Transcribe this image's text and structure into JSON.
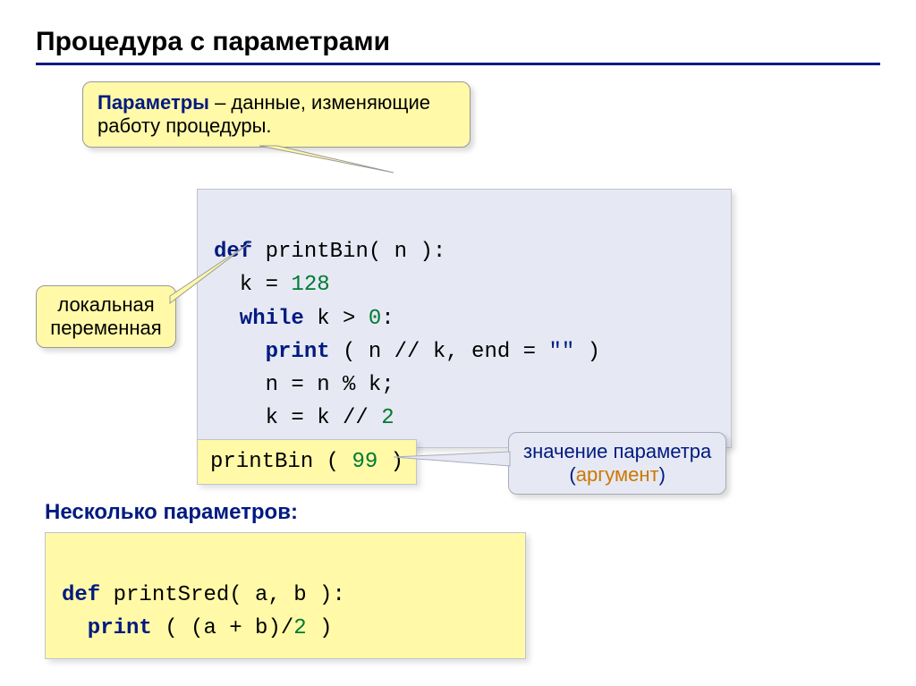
{
  "title": "Процедура с параметрами",
  "callouts": {
    "params": {
      "term": "Параметры",
      "rest": " – данные, изменяющие работу процедуры."
    },
    "localvar": "локальная переменная",
    "argvalue": {
      "line1": "значение параметра",
      "open": "(",
      "arg": "аргумент",
      "close": ")"
    }
  },
  "code_main": {
    "l1a": "def",
    "l1b": " printBin( n ):",
    "l2a": "  k = ",
    "l2n": "128",
    "l3a": "  while",
    "l3b": " k > ",
    "l3n": "0",
    "l3c": ":",
    "l4a": "    print",
    "l4b": " ( n // k, end = ",
    "l4s": "\"\"",
    "l4c": " )",
    "l5": "    n = n % k;",
    "l6a": "    k = k // ",
    "l6n": "2"
  },
  "code_call": {
    "a": "printBin ( ",
    "n": "99",
    "c": " )"
  },
  "subheading": "Несколько параметров:",
  "code_multi": {
    "l1a": "def",
    "l1b": " printSred( a, b ):",
    "l2a": "  print",
    "l2b": " ( (a + b)/",
    "l2n": "2",
    "l2c": " )"
  }
}
